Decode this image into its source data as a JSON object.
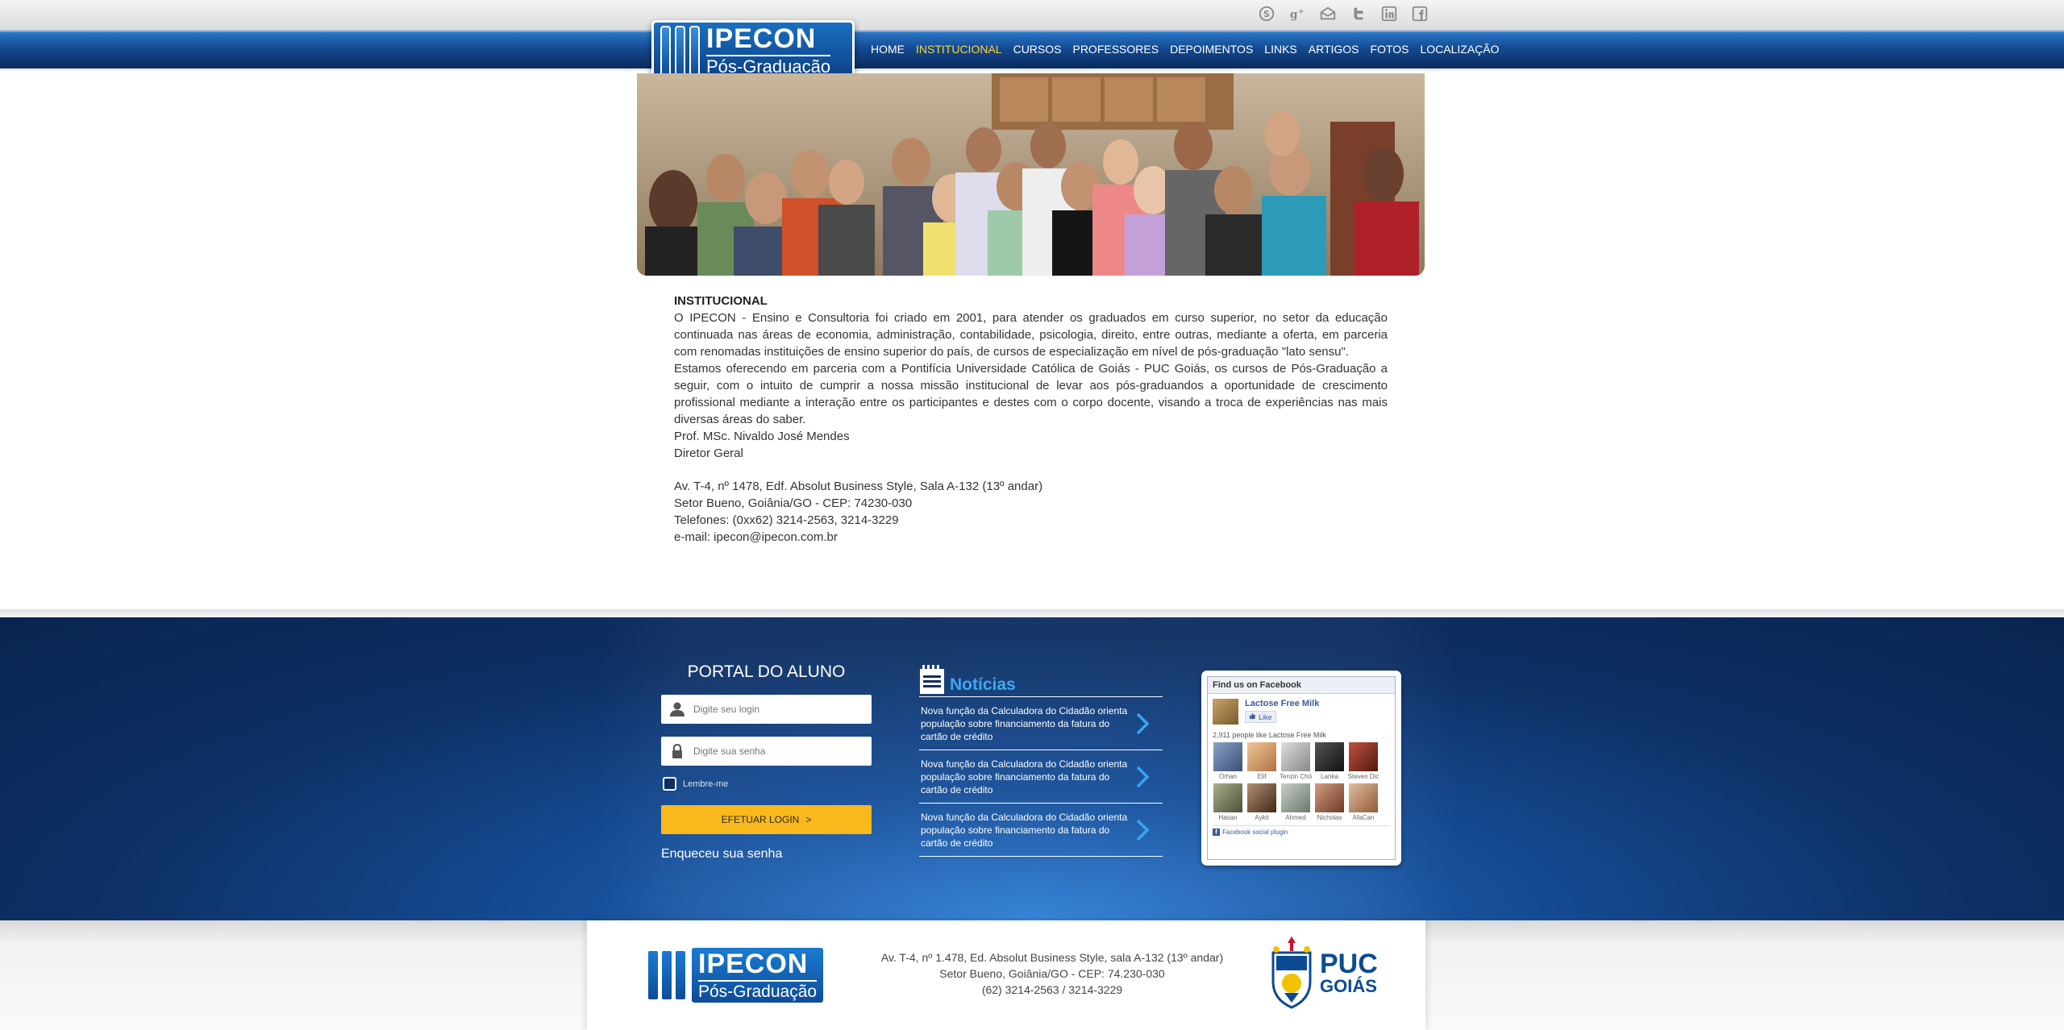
{
  "social_icons": [
    "skype-icon",
    "google-plus-icon",
    "email-icon",
    "twitter-icon",
    "linkedin-icon",
    "facebook-icon"
  ],
  "logo": {
    "title": "IPECON",
    "subtitle": "Pós-Graduação"
  },
  "nav": {
    "items": [
      {
        "label": "HOME",
        "active": false
      },
      {
        "label": "INSTITUCIONAL",
        "active": true
      },
      {
        "label": "CURSOS",
        "active": false
      },
      {
        "label": "PROFESSORES",
        "active": false
      },
      {
        "label": "DEPOIMENTOS",
        "active": false
      },
      {
        "label": "LINKS",
        "active": false
      },
      {
        "label": "ARTIGOS",
        "active": false
      },
      {
        "label": "FOTOS",
        "active": false
      },
      {
        "label": "LOCALIZAÇÃO",
        "active": false
      }
    ],
    "active_color": "#ffd33a"
  },
  "content": {
    "title": "INSTITUCIONAL",
    "p1": "O IPECON - Ensino e Consultoria foi criado em 2001, para atender os graduados em curso superior, no setor da educação continuada nas áreas de economia, administração, contabilidade, psicologia, direito, entre outras, mediante a oferta, em parceria com renomadas instituições de ensino superior do país, de cursos de especialização em nível de pós-graduação \"lato sensu\".",
    "p2": "Estamos oferecendo em parceria com a Pontifícia Universidade Católica de Goiás - PUC Goiás, os cursos de Pós-Graduação a seguir, com o intuito de cumprir a nossa missão institucional de levar aos pós-graduandos a oportunidade de crescimento profissional mediante a interação entre os participantes e destes com o corpo docente, visando a troca de experiências nas mais diversas áreas do saber.",
    "signer": "Prof. MSc. Nivaldo José Mendes",
    "signer_role": "Diretor Geral",
    "address1": "Av. T-4, nº 1478, Edf. Absolut Business Style, Sala A-132 (13º andar)",
    "address2": "Setor Bueno, Goiânia/GO - CEP: 74230-030",
    "phones": "Telefones: (0xx62) 3214-2563, 3214-3229",
    "email": "e-mail: ipecon@ipecon.com.br"
  },
  "portal": {
    "title": "PORTAL DO ALUNO",
    "login_placeholder": "Digite seu login",
    "password_placeholder": "Digite sua senha",
    "remember_label": "Lembre-me",
    "login_button": "EFETUAR LOGIN",
    "login_button_arrow": ">",
    "forgot_link": "Enqueceu sua senha",
    "button_color": "#f9b81b"
  },
  "news": {
    "title": "Notícias",
    "items": [
      {
        "text": "Nova função da Calculadora do Cidadão orienta população sobre financiamento da fatura do cartão de crédito"
      },
      {
        "text": "Nova função da Calculadora do Cidadão orienta população sobre financiamento da fatura do cartão de crédito"
      },
      {
        "text": "Nova função da Calculadora do Cidadão orienta população sobre financiamento da fatura do cartão de crédito"
      }
    ]
  },
  "facebook": {
    "header": "Find us on Facebook",
    "page_name": "Lactose Free Milk",
    "like_label": "Like",
    "count_text": "2,911 people like Lactose Free Milk",
    "people": [
      "Orhan",
      "Elif",
      "Tenzin Chö",
      "Lanka",
      "Steven Dic",
      "Hasan",
      "Aykit",
      "Ahmed",
      "Nicholas",
      "AfaCan"
    ],
    "plugin_label": "Facebook social plugin"
  },
  "footer": {
    "address_line1": "Av. T-4, nº 1.478, Ed. Absolut Business Style, sala A-132 (13º andar)",
    "address_line2": "Setor Bueno, Goiânia/GO - CEP: 74.230-030",
    "phones": "(62) 3214-2563 / 3214-3229",
    "puc_line1": "PUC",
    "puc_line2": "GOIÁS"
  }
}
